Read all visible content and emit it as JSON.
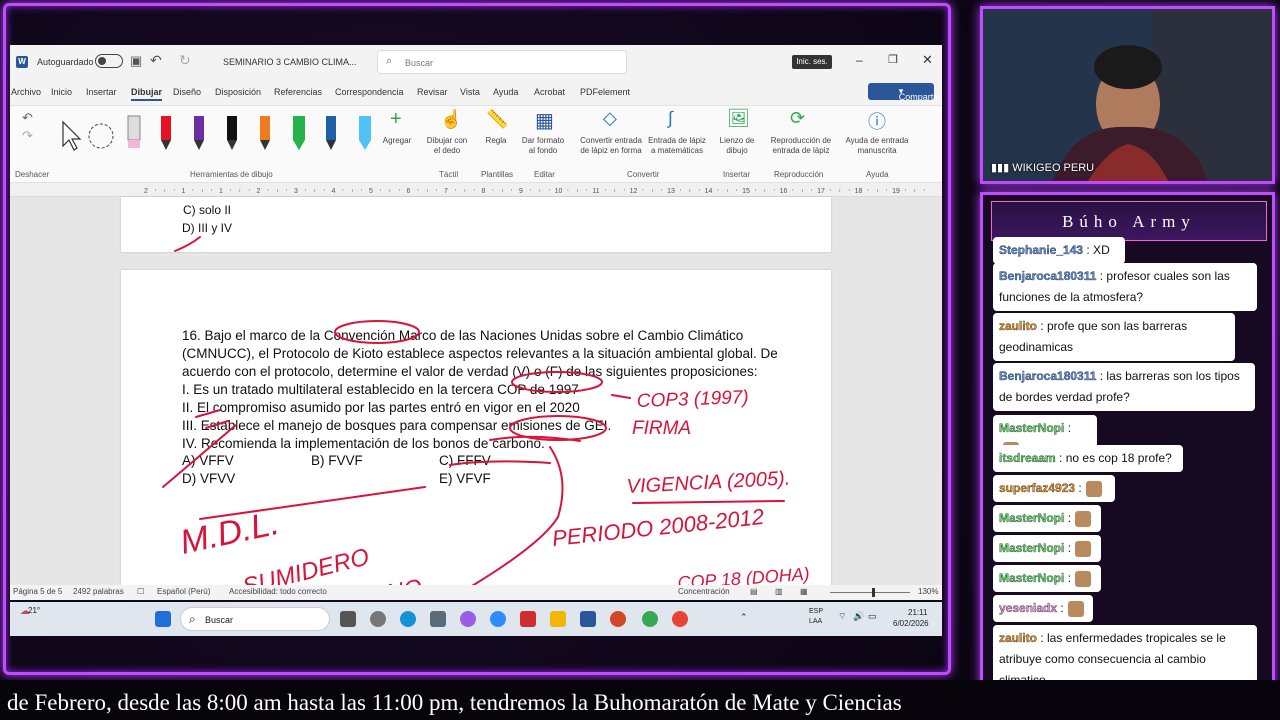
{
  "word": {
    "autosave_label": "Autoguardado",
    "doc_title": "SEMINARIO 3 CAMBIO CLIMA...",
    "search_placeholder": "Buscar",
    "signin_label": "Inic. ses.",
    "share_label": "Compartir",
    "tabs": [
      "Archivo",
      "Inicio",
      "Insertar",
      "Dibujar",
      "Diseño",
      "Disposición",
      "Referencias",
      "Correspondencia",
      "Revisar",
      "Vista",
      "Ayuda",
      "Acrobat",
      "PDFelement"
    ],
    "active_tab": "Dibujar",
    "ribbon": {
      "undo_group": "Deshacer",
      "drawing_tools_group": "Herramientas de dibujo",
      "add_label": "Agregar",
      "draw_finger": "Dibujar con el dedo",
      "tactil_group": "Táctil",
      "ruler_label": "Regla",
      "templates_group": "Plantillas",
      "format_bg": "Dar formato al fondo",
      "edit_group": "Editar",
      "ink_to_shape": "Convertir entrada de lápiz en forma",
      "ink_math": "Entrada de lápiz a matemáticas",
      "convert_group": "Convertir",
      "canvas": "Lienzo de dibujo",
      "insert_group": "Insertar",
      "replay": "Reproducción de entrada de lápiz",
      "replay_group": "Reproducción",
      "help_ink": "Ayuda de entrada manuscrita",
      "help_group": "Ayuda"
    },
    "ruler_numbers": [
      "2",
      "1",
      "1",
      "2",
      "3",
      "4",
      "5",
      "6",
      "7",
      "8",
      "9",
      "10",
      "11",
      "12",
      "13",
      "14",
      "15",
      "16",
      "17",
      "18",
      "19"
    ],
    "prev_page": {
      "opt_c": "C) solo II",
      "opt_d": "D) III y IV"
    },
    "question": {
      "lines": [
        "16. Bajo el marco de la Convención Marco de las Naciones Unidas sobre el Cambio Climático",
        "(CMNUCC), el Protocolo de Kioto establece aspectos relevantes a la situación ambiental global. De",
        "acuerdo con el protocolo, determine el valor de verdad (V) o (F) de las siguientes proposiciones:",
        "I. Es un tratado multilateral establecido en la tercera COP de 1997",
        "II. El compromiso asumido por las partes entró en vigor en el 2020",
        "III. Establece el manejo de bosques para compensar emisiones de GEI.",
        "IV. Recomienda la implementación de los bonos de carbono."
      ],
      "options": [
        {
          "id": "A",
          "text": "A) VFFV"
        },
        {
          "id": "B",
          "text": "B) FVVF"
        },
        {
          "id": "C",
          "text": "C) FFFV"
        },
        {
          "id": "D",
          "text": "D) VFVV"
        },
        {
          "id": "E",
          "text": "E) VFVF"
        }
      ]
    },
    "handwriting": {
      "cop": "COP3 (1997)",
      "firma": "FIRMA",
      "vigencia": "VIGENCIA (2005).",
      "mdl": "M.D.L.",
      "sumidero": "SUMIDERO",
      "de": "DE",
      "ano": "DANO.",
      "periodo": "PERIODO 2008-2012",
      "cop18": "COP 18 (DOHA)"
    },
    "status": {
      "page": "Página 5 de 5",
      "words": "2492 palabras",
      "language": "Español (Perú)",
      "accessibility": "Accesibilidad: todo correcto",
      "focus": "Concentración",
      "zoom": "130%"
    }
  },
  "taskbar": {
    "weather": "21°",
    "search_placeholder": "Buscar",
    "lang": "ESP",
    "lang2": "LAA",
    "time": "21:11",
    "date": "6/02/2026"
  },
  "webcam": {
    "label": "WIKIGEO PERU"
  },
  "chat": {
    "title": "Búho Army",
    "messages": [
      {
        "user": "Stephanie_143",
        "text": ": XD",
        "color": "blue"
      },
      {
        "user": "Benjaroca180311",
        "text": ": profesor cuales son las funciones de la atmosfera?",
        "color": "blue"
      },
      {
        "user": "zaulito",
        "text": ": profe que son las barreras geodinamicas",
        "color": "orange"
      },
      {
        "user": "Benjaroca180311",
        "text": ": las barreras son los tipos de bordes verdad profe?",
        "color": "blue"
      },
      {
        "user": "MasterNopi",
        "text": ":",
        "color": "green"
      },
      {
        "user": "itsdreaam",
        "text": ": no es cop 18 profe?",
        "color": "green"
      },
      {
        "user": "superfaz4923",
        "text": ":",
        "color": "orange"
      },
      {
        "user": "MasterNopi",
        "text": ":",
        "color": "green"
      },
      {
        "user": "MasterNopi",
        "text": ":",
        "color": "green"
      },
      {
        "user": "MasterNopi",
        "text": ":",
        "color": "green"
      },
      {
        "user": "yeseniadx",
        "text": ":",
        "color": "pink"
      },
      {
        "user": "zaulito",
        "text": ": las enfermedades tropicales se le atribuye como consecuencia al cambio climatico",
        "color": "orange"
      }
    ]
  },
  "ticker": {
    "text": "de Febrero, desde las 8:00 am hasta las 11:00 pm, tendremos la Buhomaratón de Mate y Ciencias"
  },
  "colors": {
    "accent_neon": "#c04bff",
    "ink_red": "#d8143a",
    "word_blue": "#2b579a"
  }
}
